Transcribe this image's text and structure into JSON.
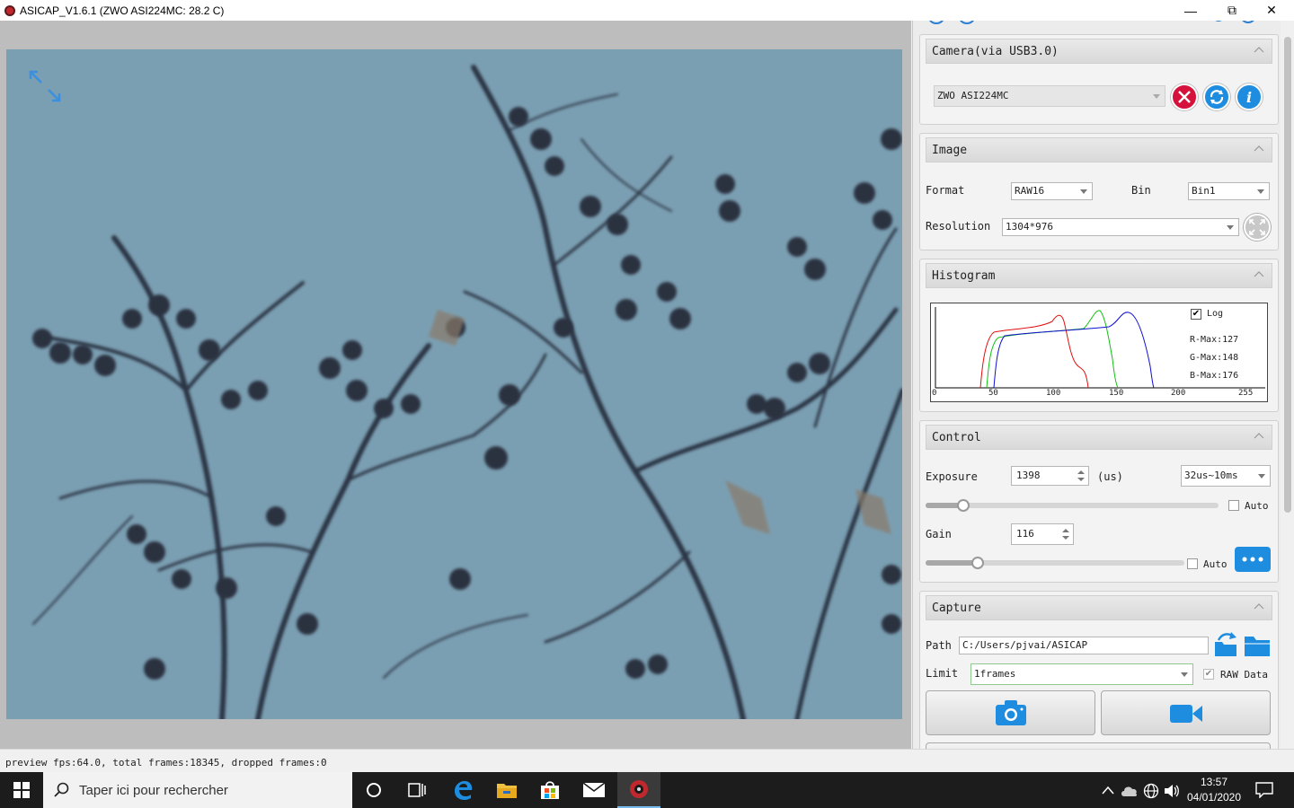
{
  "window": {
    "title": "ASICAP_V1.6.1 (ZWO ASI224MC: 28.2 C)"
  },
  "camera": {
    "title": "Camera(via USB3.0)",
    "selected": "ZWO ASI224MC"
  },
  "image": {
    "title": "Image",
    "format_label": "Format",
    "format_value": "RAW16",
    "bin_label": "Bin",
    "bin_value": "Bin1",
    "resolution_label": "Resolution",
    "resolution_value": "1304*976"
  },
  "histogram": {
    "title": "Histogram",
    "log_label": "Log",
    "log_checked": true,
    "r_max": "R-Max:127",
    "g_max": "G-Max:148",
    "b_max": "B-Max:176",
    "x_ticks": [
      "0",
      "50",
      "100",
      "150",
      "200",
      "255"
    ],
    "colors": {
      "red": "#e01010",
      "green": "#10c010",
      "blue": "#1010d0"
    }
  },
  "control": {
    "title": "Control",
    "exposure_label": "Exposure",
    "exposure_value": "1398",
    "exposure_unit": "(us)",
    "exposure_range": "32us~10ms",
    "exposure_auto_label": "Auto",
    "exposure_slider": 0.13,
    "gain_label": "Gain",
    "gain_value": "116",
    "gain_auto_label": "Auto",
    "gain_slider": 0.2
  },
  "capture": {
    "title": "Capture",
    "path_label": "Path",
    "path_value": "C:/Users/pjvai/ASICAP",
    "limit_label": "Limit",
    "limit_value": "1frames",
    "raw_data_label": "RAW Data",
    "raw_data_checked": true
  },
  "status": {
    "text": "preview fps:64.0, total frames:18345, dropped frames:0"
  },
  "taskbar": {
    "search_placeholder": "Taper ici pour rechercher",
    "time": "13:57",
    "date": "04/01/2020"
  },
  "accent": "#1e8de0"
}
